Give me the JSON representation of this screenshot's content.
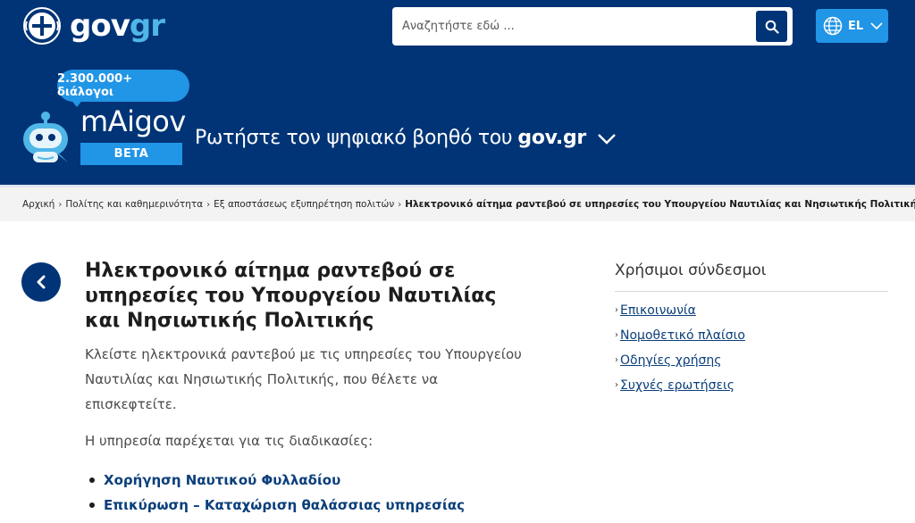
{
  "header": {
    "logo": {
      "gov": "gov",
      "gr": "gr"
    },
    "search": {
      "placeholder": "Αναζητήστε εδώ ..."
    },
    "language": {
      "label": "EL"
    },
    "assistant": {
      "bubble": "2.300.000+ διάλογοι",
      "name": "mAigov",
      "badge": "BETA",
      "prompt": "Ρωτήστε τον ψηφιακό βοηθό του",
      "prompt_brand": "gov.gr"
    }
  },
  "breadcrumb": {
    "items": [
      "Αρχική",
      "Πολίτης και καθημερινότητα",
      "Εξ αποστάσεως εξυπηρέτηση πολιτών"
    ],
    "current": "Ηλεκτρονικό αίτημα ραντεβού σε υπηρεσίες του Υπουργείου Ναυτιλίας και Νησιωτικής Πολιτικής"
  },
  "main": {
    "title": "Ηλεκτρονικό αίτημα ραντεβού σε υπηρεσίες του Υπουργείου Ναυτιλίας και Νησιωτικής Πολιτικής",
    "lead": "Κλείστε ηλεκτρονικά ραντεβού με τις υπηρεσίες του Υπουργείου Ναυτιλίας και Νησιωτικής Πολιτικής, που θέλετε να επισκεφτείτε.",
    "intro": "Η υπηρεσία παρέχεται για τις διαδικασίες:",
    "procedures": [
      "Χορήγηση Ναυτικού Φυλλαδίου",
      "Επικύρωση – Καταχώριση θαλάσσιας υπηρεσίας"
    ]
  },
  "sidebar": {
    "title": "Χρήσιμοι σύνδεσμοι",
    "links": [
      "Επικοινωνία",
      "Νομοθετικό πλαίσιο",
      "Οδηγίες χρήσης",
      "Συχνές ερωτήσεις"
    ]
  },
  "colors": {
    "brand": "#003476",
    "accent": "#2195e6",
    "link": "#0b3f7a",
    "logo_gr": "#4fb6e8"
  }
}
